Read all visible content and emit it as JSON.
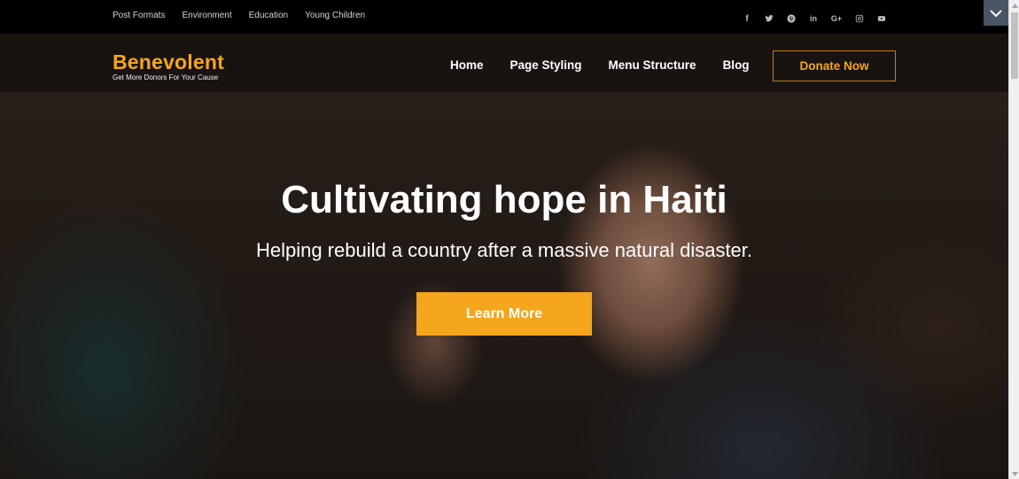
{
  "topbar": {
    "links": [
      "Post Formats",
      "Environment",
      "Education",
      "Young Children"
    ],
    "social_icons": [
      "facebook-icon",
      "twitter-icon",
      "pinterest-icon",
      "linkedin-icon",
      "google-plus-icon",
      "instagram-icon",
      "youtube-icon"
    ],
    "social_glyphs": {
      "facebook": "f",
      "linkedin": "in",
      "google_plus": "G+"
    }
  },
  "header": {
    "brand_name": "Benevolent",
    "tagline": "Get More Donors For Your Cause",
    "nav": [
      "Home",
      "Page Styling",
      "Menu Structure",
      "Blog"
    ],
    "donate_label": "Donate Now"
  },
  "hero": {
    "title": "Cultivating hope in Haiti",
    "subtitle": "Helping rebuild a country after a massive natural disaster.",
    "cta_label": "Learn More"
  },
  "colors": {
    "accent": "#f5a61c",
    "topbar_bg": "#000000",
    "toggle_bg": "#4a5566"
  }
}
